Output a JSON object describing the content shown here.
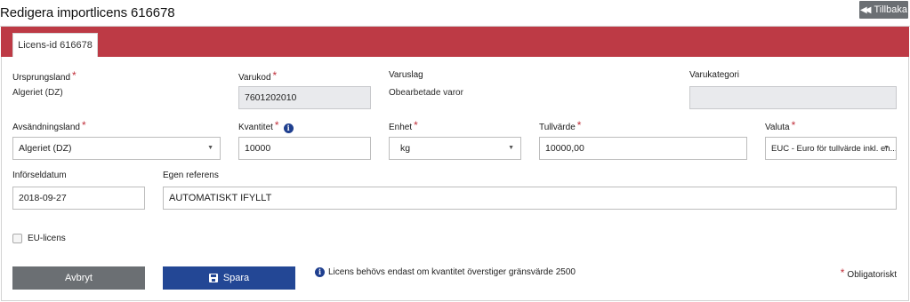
{
  "header": {
    "title": "Redigera importlicens 616678",
    "back_label": "Tillbaka"
  },
  "tab": {
    "label": "Licens-id 616678"
  },
  "fields": {
    "ursprungsland": {
      "label": "Ursprungsland",
      "value": "Algeriet (DZ)"
    },
    "varukod": {
      "label": "Varukod",
      "value": "7601202010"
    },
    "varuslag": {
      "label": "Varuslag",
      "value": "Obearbetade varor"
    },
    "varukategori": {
      "label": "Varukategori",
      "value": ""
    },
    "avsandningsland": {
      "label": "Avsändningsland",
      "value": "Algeriet (DZ)"
    },
    "kvantitet": {
      "label": "Kvantitet",
      "value": "10000"
    },
    "enhet": {
      "label": "Enhet",
      "value": "kg"
    },
    "tullvarde": {
      "label": "Tullvärde",
      "value": "10000,00"
    },
    "valuta": {
      "label": "Valuta",
      "value": "EUC - Euro för tullvärde inkl. en..."
    },
    "inforseldatum": {
      "label": "Införseldatum",
      "value": "2018-09-27"
    },
    "egen_referens": {
      "label": "Egen referens",
      "value": "AUTOMATISKT IFYLLT"
    }
  },
  "eu_licens": {
    "label": "EU-licens",
    "checked": false
  },
  "actions": {
    "cancel_label": "Avbryt",
    "save_label": "Spara"
  },
  "notice": "Licens behövs endast om kvantitet överstiger gränsvärde 2500",
  "legend": "Obligatoriskt",
  "required_marker": "*",
  "info_glyph": "i",
  "colors": {
    "header_bar": "#bd3a45",
    "save_button": "#234795",
    "cancel_button": "#6b6f73",
    "required": "#c0303b"
  }
}
